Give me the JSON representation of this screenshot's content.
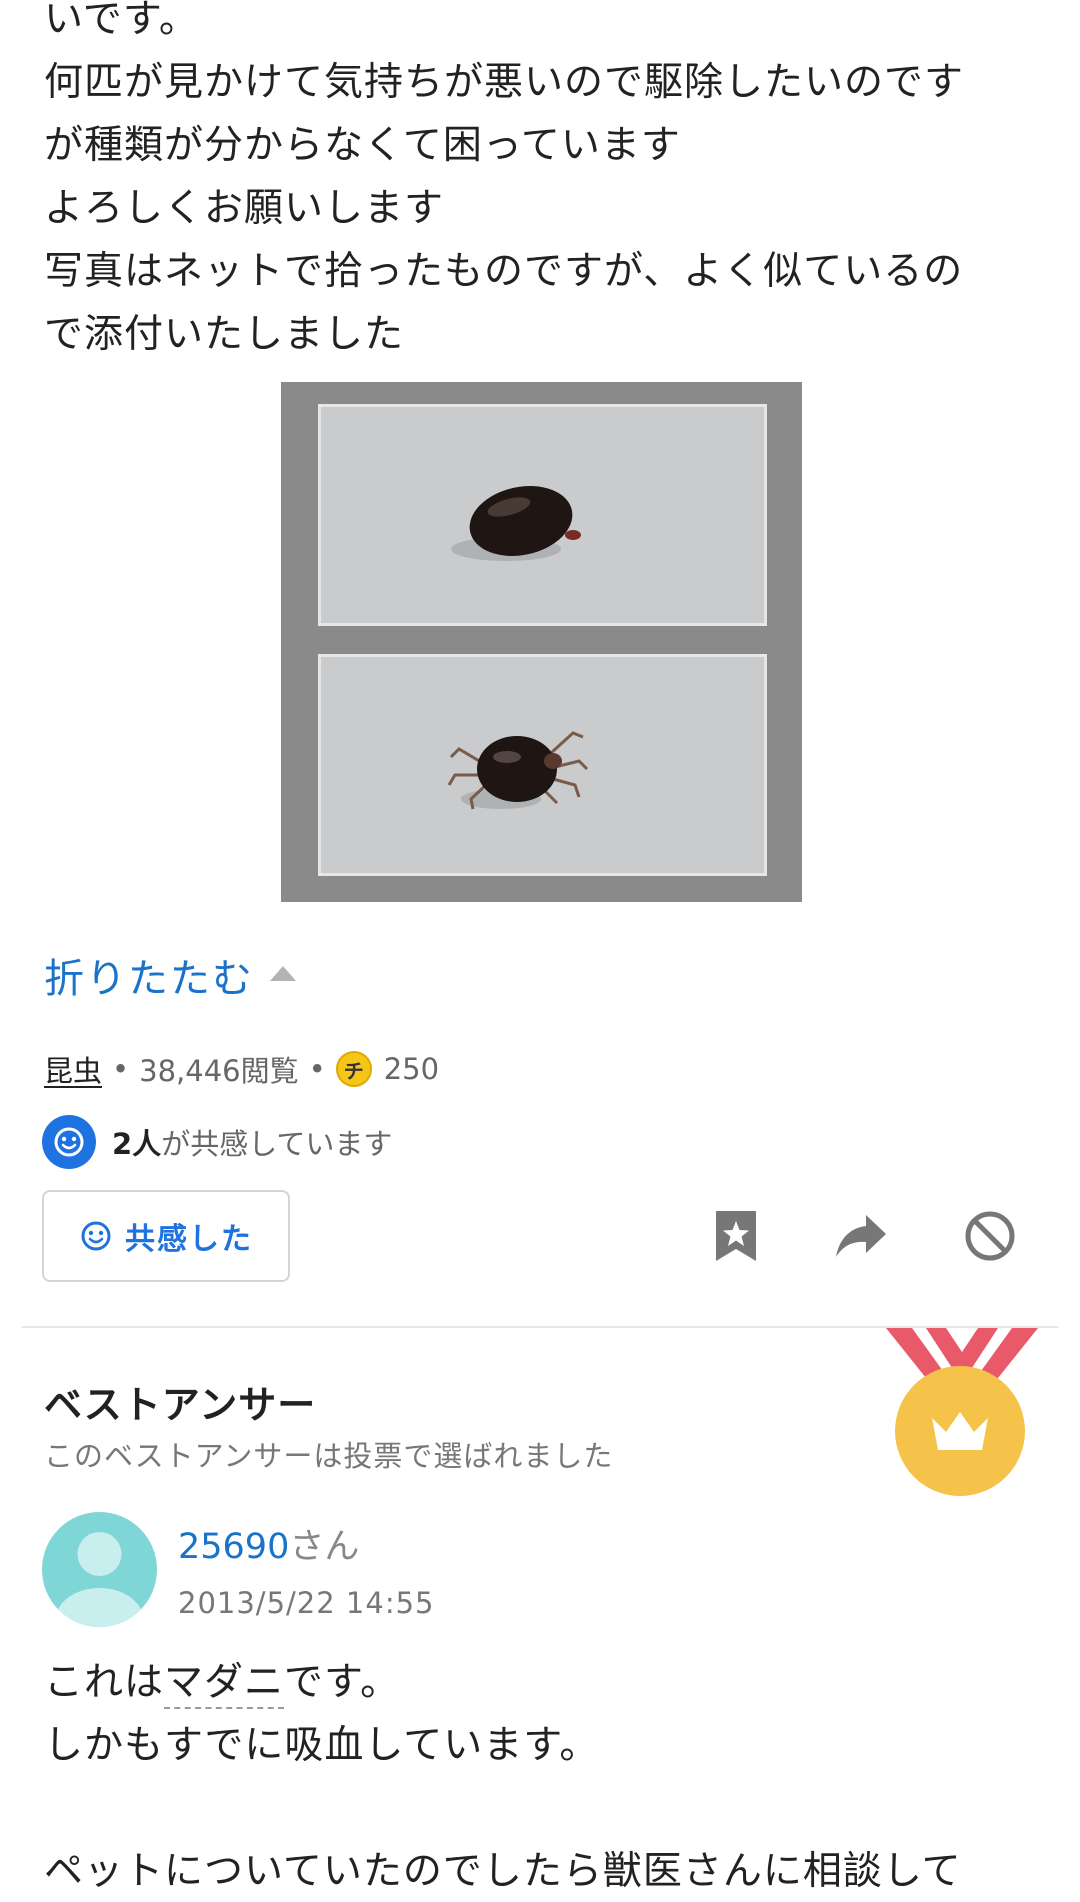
{
  "question": {
    "lines": [
      "いです。",
      "何匹が見かけて気持ちが悪いので駆除したいのです",
      "が種類が分からなくて困っています",
      "よろしくお願いします",
      "写真はネットで拾ったものですが、よく似ているの",
      "で添付いたしました"
    ],
    "fold_label": "折りたたむ"
  },
  "meta": {
    "category": "昆虫",
    "views": "38,446閲覧",
    "coin_icon_label": "チ",
    "coins": "250"
  },
  "empathy": {
    "count": "2人",
    "suffix": "が共感しています",
    "button_label": "共感した"
  },
  "best_answer": {
    "title": "ベストアンサー",
    "subtitle": "このベストアンサーは投票で選ばれました",
    "user_name": "25690",
    "user_suffix": "さん",
    "date": "2013/5/22 14:55",
    "text_line1_a": "これは",
    "text_line1_keyword": "マダニ",
    "text_line1_b": "です。",
    "text_line2": "しかもすでに吸血しています。",
    "text_line3": "",
    "text_line4": "ペットについていたのでしたら獣医さんに相談して"
  },
  "colors": {
    "link": "#1a73c8",
    "accent": "#1f73e0",
    "medal": "#f6c34a",
    "ribbon": "#e85a6a"
  },
  "icons": [
    "smiley-icon",
    "bookmark-icon",
    "share-icon",
    "report-icon",
    "crown-icon",
    "chevron-up-icon"
  ]
}
